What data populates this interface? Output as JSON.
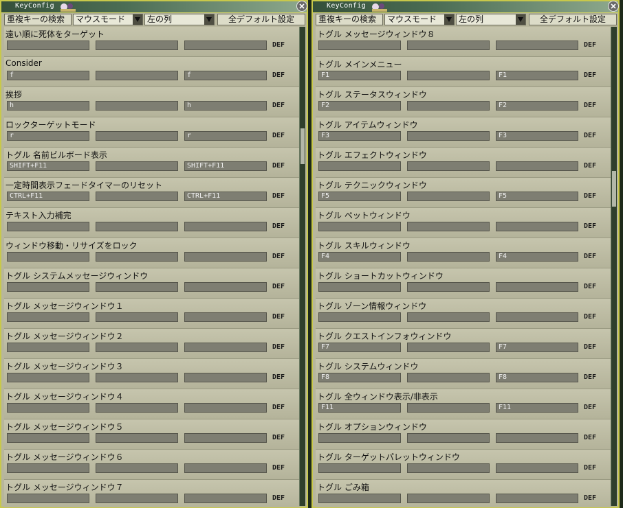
{
  "windows": [
    {
      "id": "left",
      "title": "KeyConfig",
      "toolbar": {
        "search_button": "重複キーの検索",
        "mode_select": "マウスモード",
        "column_select": "左の列",
        "default_all_button": "全デフォルト設定"
      },
      "def_label": "DEF",
      "rows": [
        {
          "label": "遠い順に死体をターゲット",
          "k1": "",
          "k2": "",
          "k3": ""
        },
        {
          "label": "Consider",
          "k1": "f",
          "k2": "",
          "k3": "f"
        },
        {
          "label": "挨拶",
          "k1": "h",
          "k2": "",
          "k3": "h"
        },
        {
          "label": "ロックターゲットモード",
          "k1": "r",
          "k2": "",
          "k3": "r"
        },
        {
          "label": "トグル 名前ビルボード表示",
          "k1": "SHIFT+F11",
          "k2": "",
          "k3": "SHIFT+F11"
        },
        {
          "label": "一定時間表示フェードタイマーのリセット",
          "k1": "CTRL+F11",
          "k2": "",
          "k3": "CTRL+F11"
        },
        {
          "label": "テキスト入力補完",
          "k1": "",
          "k2": "",
          "k3": ""
        },
        {
          "label": "ウィンドウ移動・リサイズをロック",
          "k1": "",
          "k2": "",
          "k3": ""
        },
        {
          "label": "トグル システムメッセージウィンドウ",
          "k1": "",
          "k2": "",
          "k3": ""
        },
        {
          "label": "トグル メッセージウィンドウ１",
          "k1": "",
          "k2": "",
          "k3": ""
        },
        {
          "label": "トグル メッセージウィンドウ２",
          "k1": "",
          "k2": "",
          "k3": ""
        },
        {
          "label": "トグル メッセージウィンドウ３",
          "k1": "",
          "k2": "",
          "k3": ""
        },
        {
          "label": "トグル メッセージウィンドウ４",
          "k1": "",
          "k2": "",
          "k3": ""
        },
        {
          "label": "トグル メッセージウィンドウ５",
          "k1": "",
          "k2": "",
          "k3": ""
        },
        {
          "label": "トグル メッセージウィンドウ６",
          "k1": "",
          "k2": "",
          "k3": ""
        },
        {
          "label": "トグル メッセージウィンドウ７",
          "k1": "",
          "k2": "",
          "k3": ""
        }
      ]
    },
    {
      "id": "right",
      "title": "KeyConfig",
      "toolbar": {
        "search_button": "重複キーの検索",
        "mode_select": "マウスモード",
        "column_select": "左の列",
        "default_all_button": "全デフォルト設定"
      },
      "def_label": "DEF",
      "rows": [
        {
          "label": "トグル メッセージウィンドウ８",
          "k1": "",
          "k2": "",
          "k3": ""
        },
        {
          "label": "トグル メインメニュー",
          "k1": "F1",
          "k2": "",
          "k3": "F1"
        },
        {
          "label": "トグル ステータスウィンドウ",
          "k1": "F2",
          "k2": "",
          "k3": "F2"
        },
        {
          "label": "トグル アイテムウィンドウ",
          "k1": "F3",
          "k2": "",
          "k3": "F3"
        },
        {
          "label": "トグル エフェクトウィンドウ",
          "k1": "",
          "k2": "",
          "k3": ""
        },
        {
          "label": "トグル テクニックウィンドウ",
          "k1": "F5",
          "k2": "",
          "k3": "F5"
        },
        {
          "label": "トグル ペットウィンドウ",
          "k1": "",
          "k2": "",
          "k3": ""
        },
        {
          "label": "トグル スキルウィンドウ",
          "k1": "F4",
          "k2": "",
          "k3": "F4"
        },
        {
          "label": "トグル ショートカットウィンドウ",
          "k1": "",
          "k2": "",
          "k3": ""
        },
        {
          "label": "トグル ゾーン情報ウィンドウ",
          "k1": "",
          "k2": "",
          "k3": ""
        },
        {
          "label": "トグル クエストインフォウィンドウ",
          "k1": "F7",
          "k2": "",
          "k3": "F7"
        },
        {
          "label": "トグル システムウィンドウ",
          "k1": "F8",
          "k2": "",
          "k3": "F8"
        },
        {
          "label": "トグル 全ウィンドウ表示/非表示",
          "k1": "F11",
          "k2": "",
          "k3": "F11"
        },
        {
          "label": "トグル オプションウィンドウ",
          "k1": "",
          "k2": "",
          "k3": ""
        },
        {
          "label": "トグル ターゲットパレットウィンドウ",
          "k1": "",
          "k2": "",
          "k3": ""
        },
        {
          "label": "トグル ごみ箱",
          "k1": "",
          "k2": "",
          "k3": ""
        }
      ]
    }
  ]
}
